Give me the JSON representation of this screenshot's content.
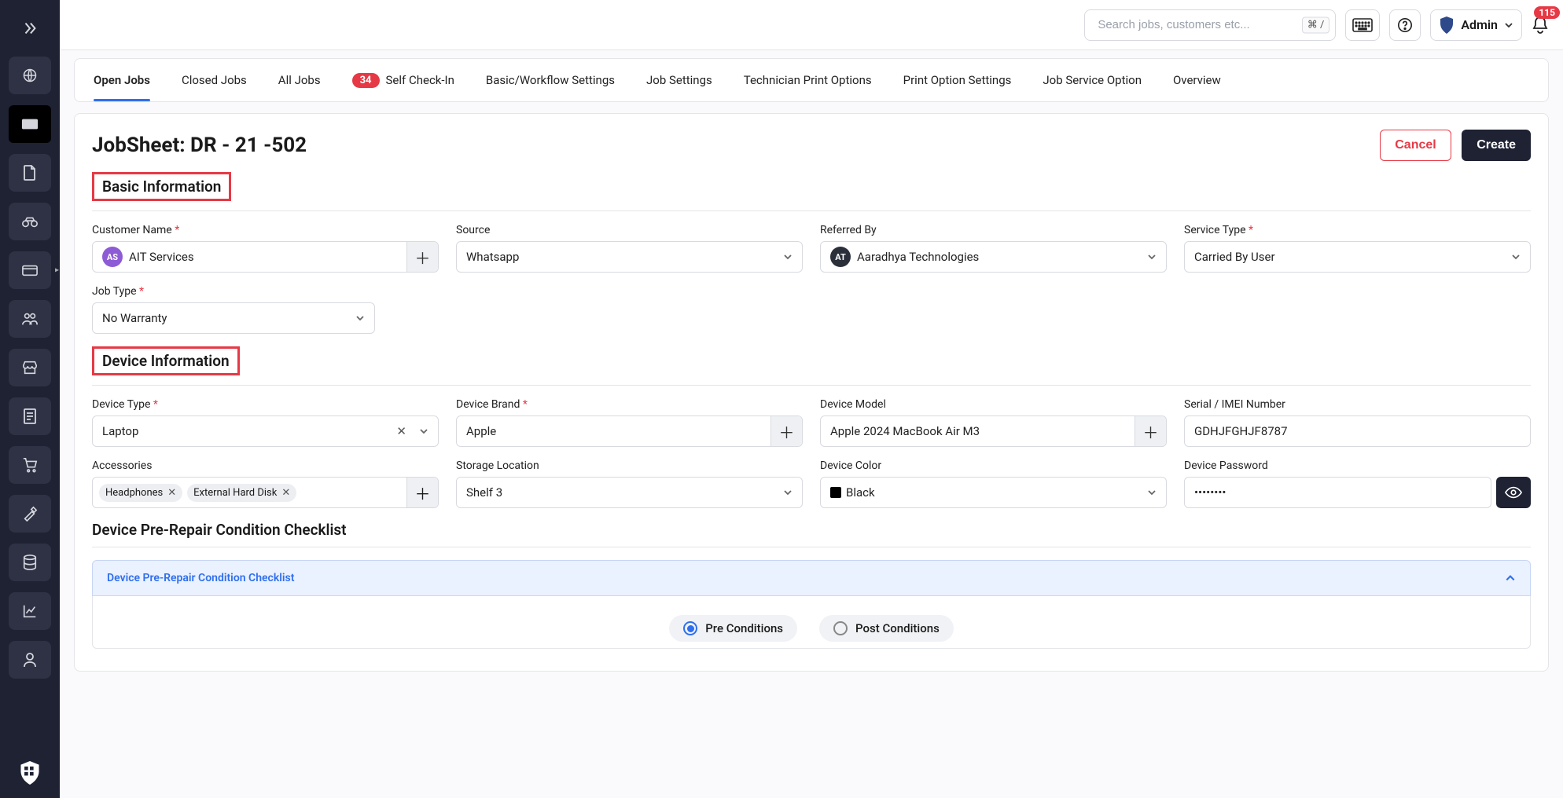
{
  "topbar": {
    "search_placeholder": "Search jobs, customers etc...",
    "search_shortcut": "⌘ /",
    "profile_label": "Admin",
    "notification_count": "115"
  },
  "tabs": [
    {
      "label": "Open Jobs",
      "active": true
    },
    {
      "label": "Closed Jobs"
    },
    {
      "label": "All Jobs"
    },
    {
      "label": "Self Check-In",
      "badge": "34"
    },
    {
      "label": "Basic/Workflow Settings"
    },
    {
      "label": "Job Settings"
    },
    {
      "label": "Technician Print Options"
    },
    {
      "label": "Print Option Settings"
    },
    {
      "label": "Job Service Option"
    },
    {
      "label": "Overview"
    }
  ],
  "page": {
    "title": "JobSheet: DR - 21 -502",
    "cancel": "Cancel",
    "create": "Create"
  },
  "basic": {
    "section": "Basic Information",
    "customer_label": "Customer Name",
    "customer_initials": "AS",
    "customer_value": "AIT Services",
    "source_label": "Source",
    "source_value": "Whatsapp",
    "referred_label": "Referred By",
    "referred_initials": "AT",
    "referred_value": "Aaradhya Technologies",
    "service_label": "Service Type",
    "service_value": "Carried By User",
    "jobtype_label": "Job Type",
    "jobtype_value": "No Warranty"
  },
  "device": {
    "section": "Device Information",
    "type_label": "Device Type",
    "type_value": "Laptop",
    "brand_label": "Device Brand",
    "brand_value": "Apple",
    "model_label": "Device Model",
    "model_value": "Apple 2024 MacBook Air M3",
    "serial_label": "Serial / IMEI Number",
    "serial_value": "GDHJFGHJF8787",
    "accessories_label": "Accessories",
    "accessories": [
      "Headphones",
      "External Hard Disk"
    ],
    "storage_label": "Storage Location",
    "storage_value": "Shelf 3",
    "color_label": "Device Color",
    "color_value": "Black",
    "color_hex": "#000000",
    "password_label": "Device Password",
    "password_value": "••••••••"
  },
  "checklist": {
    "heading": "Device Pre-Repair Condition Checklist",
    "accordion_title": "Device Pre-Repair Condition Checklist",
    "pre": "Pre Conditions",
    "post": "Post Conditions"
  }
}
